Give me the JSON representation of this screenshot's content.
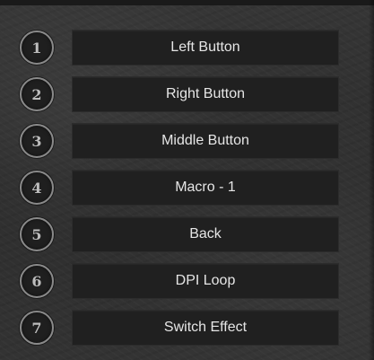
{
  "buttons": [
    {
      "number": "1",
      "label": "Left Button"
    },
    {
      "number": "2",
      "label": "Right Button"
    },
    {
      "number": "3",
      "label": "Middle Button"
    },
    {
      "number": "4",
      "label": "Macro - 1"
    },
    {
      "number": "5",
      "label": "Back"
    },
    {
      "number": "6",
      "label": "DPI Loop"
    },
    {
      "number": "7",
      "label": "Switch Effect"
    }
  ]
}
